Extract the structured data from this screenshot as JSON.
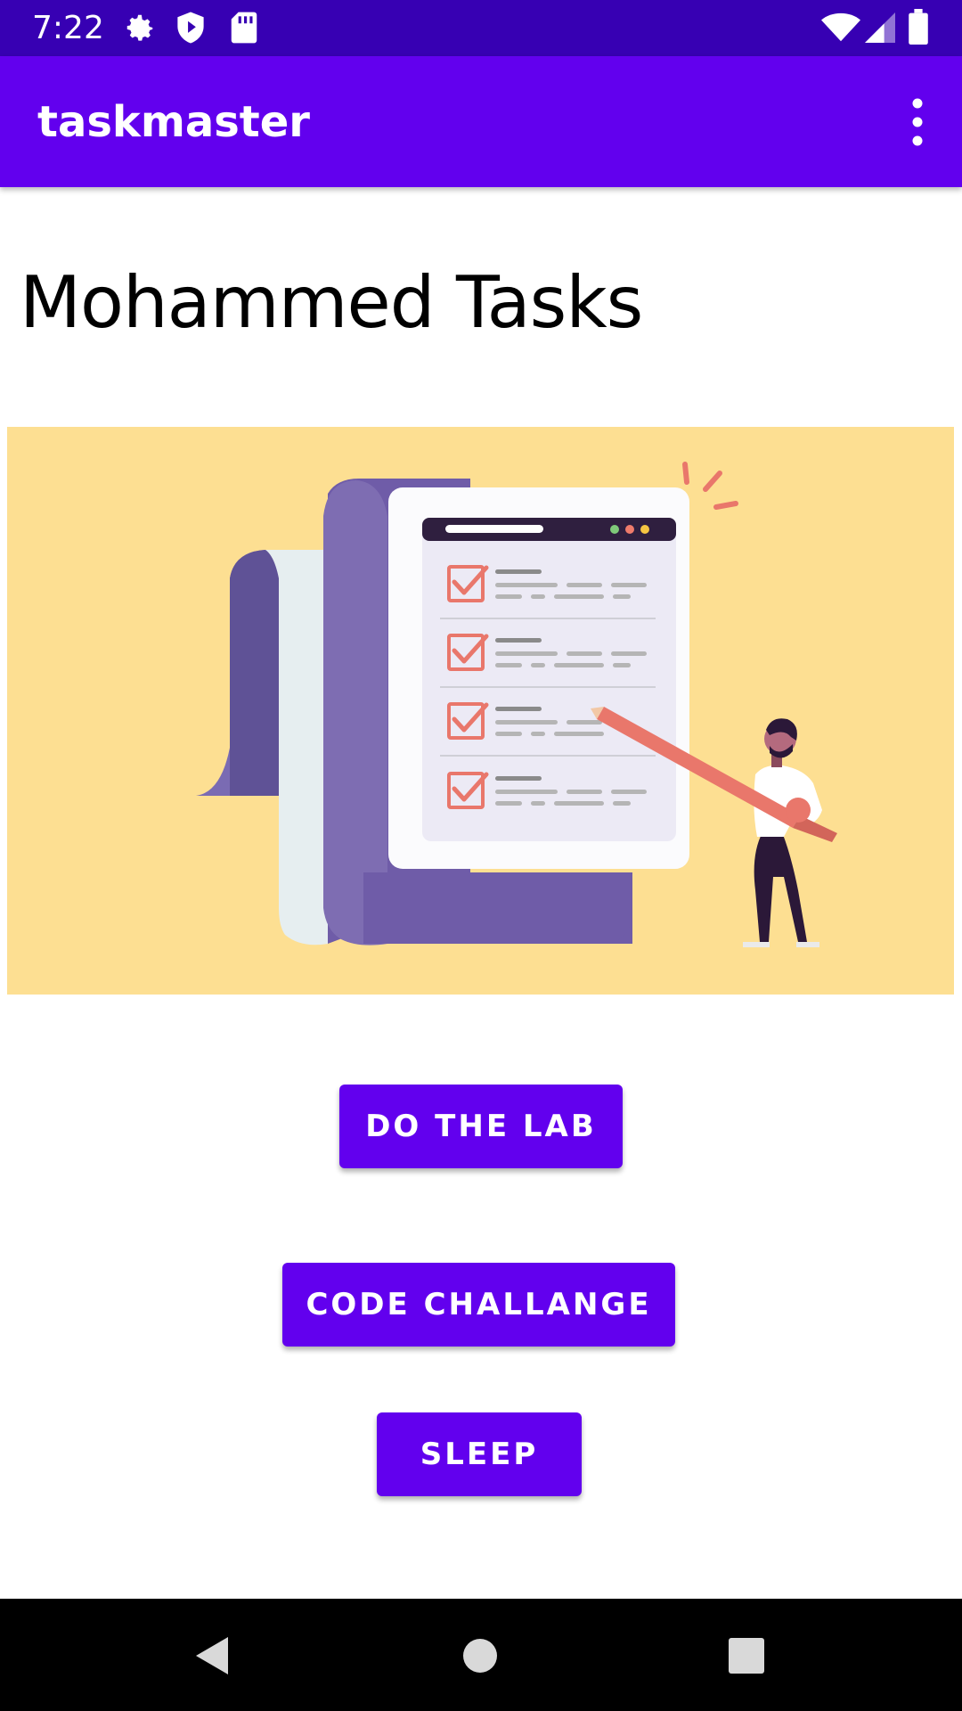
{
  "status_bar": {
    "time": "7:22",
    "left_icons": [
      "gear-icon",
      "shield-icon",
      "sd-card-icon"
    ],
    "right_icons": [
      "wifi-icon",
      "cell-signal-icon",
      "battery-icon"
    ]
  },
  "app_bar": {
    "title": "taskmaster",
    "menu_icon": "overflow-menu-icon"
  },
  "main": {
    "heading": "Mohammed Tasks",
    "buttons": [
      {
        "label": "DO THE LAB"
      },
      {
        "label": "CODE CHALLANGE"
      },
      {
        "label": "SLEEP"
      }
    ]
  },
  "nav_bar": {
    "icons": [
      "back-icon",
      "home-icon",
      "recents-icon"
    ]
  },
  "colors": {
    "status_bar": "#3700b3",
    "app_bar": "#6200ee",
    "button": "#6200ee",
    "hero_background": "#fddf92"
  }
}
